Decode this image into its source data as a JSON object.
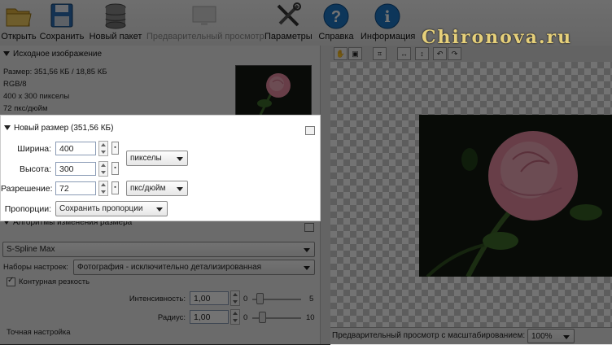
{
  "toolbar": {
    "buttons": [
      {
        "label": "Открыть",
        "icon": "folder-open-icon"
      },
      {
        "label": "Сохранить",
        "icon": "floppy-disk-icon"
      },
      {
        "label": "Новый пакет",
        "icon": "database-stack-icon"
      },
      {
        "label": "Предварительный просмотр",
        "icon": "preview-screen-icon"
      },
      {
        "label": "Параметры",
        "icon": "tools-icon"
      },
      {
        "label": "Справка",
        "icon": "help-icon"
      },
      {
        "label": "Информация",
        "icon": "info-icon"
      }
    ]
  },
  "watermark": "Chironova.ru",
  "source": {
    "header": "Исходное изображение",
    "size": "Размер: 351,56 КБ / 18,85 КБ",
    "mode": "RGB/8",
    "dims": "400 x 300 пикселы",
    "dpi": "72 пкс/дюйм"
  },
  "new_size": {
    "header": "Новый размер (351,56 КБ)",
    "width_label": "Ширина:",
    "width_value": "400",
    "height_label": "Высота:",
    "height_value": "300",
    "resolution_label": "Разрешение:",
    "resolution_value": "72",
    "proportions_label": "Пропорции:",
    "proportions_value": "Сохранить пропорции",
    "units_value": "пикселы",
    "res_units_value": "пкс/дюйм"
  },
  "algorithms": {
    "header": "Алгоритмы изменения размера",
    "method": "S-Spline Max",
    "presets_label": "Наборы настроек:",
    "presets_value": "Фотография - исключительно детализированная",
    "sharpness_label": "Контурная резкость",
    "intensity_label": "Интенсивность:",
    "intensity_value": "1,00",
    "intensity_min": "0",
    "intensity_max": "5",
    "radius_label": "Радиус:",
    "radius_value": "1,00",
    "radius_min": "0",
    "radius_max": "10",
    "fine_tune": "Точная настройка"
  },
  "preview": {
    "zoom_label": "Предварительный просмотр с масштабированием:",
    "zoom_value": "100%"
  },
  "colors": {
    "accent_help": "#1e78c8",
    "watermark": "#e6d07a",
    "rose": "#e68aa0"
  }
}
